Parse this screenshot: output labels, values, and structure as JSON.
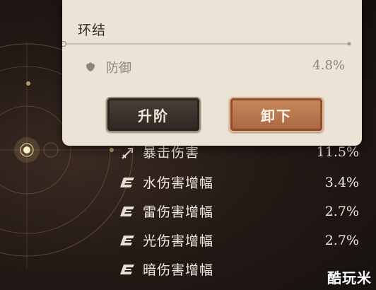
{
  "card": {
    "title": "环结",
    "attribute": {
      "icon": "defense-shield-icon",
      "name": "防御",
      "value": "4.8%"
    },
    "buttons": {
      "upgrade": "升阶",
      "unequip": "卸下"
    }
  },
  "stats": [
    {
      "icon": "crit-sword-icon",
      "name": "暴击伤害",
      "value": "11.5%"
    },
    {
      "icon": "element-boost-icon",
      "name": "水伤害增幅",
      "value": "3.4%"
    },
    {
      "icon": "element-boost-icon",
      "name": "雷伤害增幅",
      "value": "2.7%"
    },
    {
      "icon": "element-boost-icon",
      "name": "光伤害增幅",
      "value": "2.7%"
    },
    {
      "icon": "element-boost-icon",
      "name": "暗伤害增幅",
      "value": ""
    }
  ],
  "watermark": "酷玩米",
  "colors": {
    "card_bg": "#ece3d6",
    "unequip_button": "#b8744c",
    "upgrade_button": "#3a302a"
  }
}
